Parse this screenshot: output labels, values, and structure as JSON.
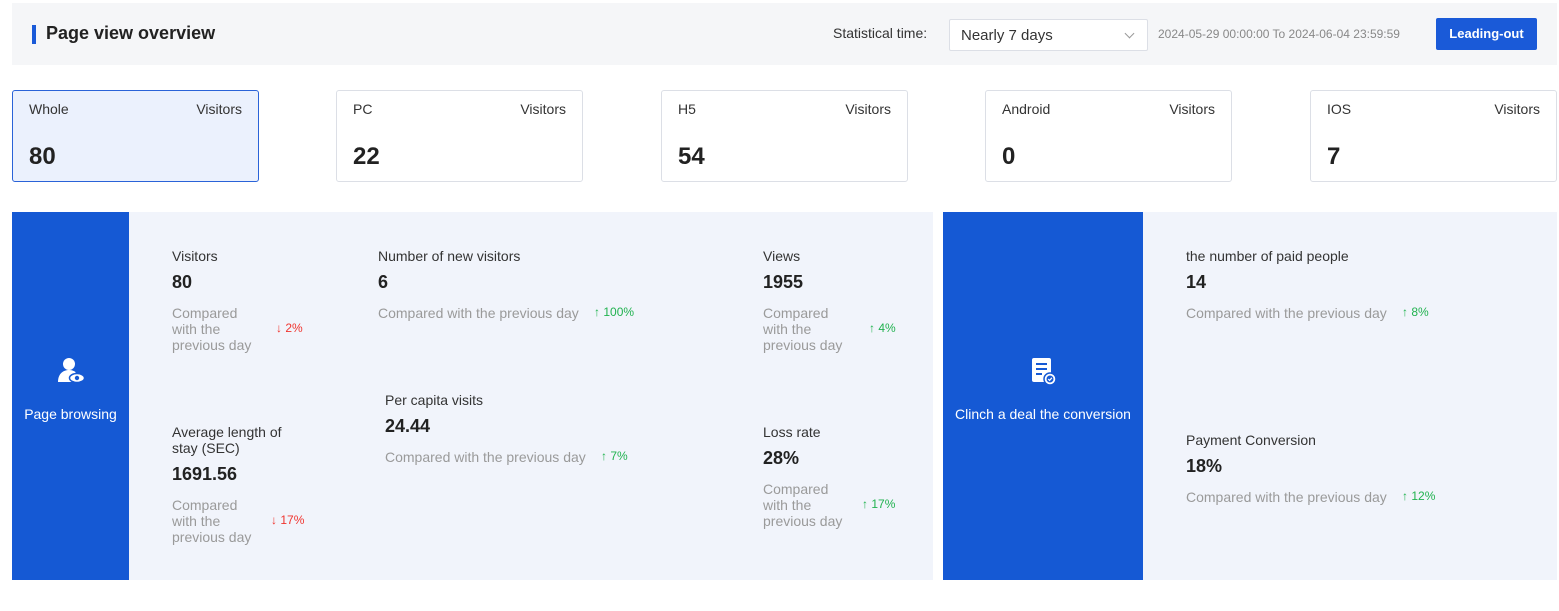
{
  "header": {
    "title": "Page view overview",
    "stat_label": "Statistical time:",
    "range_select": "Nearly 7 days",
    "range_text": "2024-05-29 00:00:00 To 2024-06-04 23:59:59",
    "export_label": "Leading-out"
  },
  "cards": [
    {
      "name": "Whole",
      "label": "Visitors",
      "value": "80"
    },
    {
      "name": "PC",
      "label": "Visitors",
      "value": "22"
    },
    {
      "name": "H5",
      "label": "Visitors",
      "value": "54"
    },
    {
      "name": "Android",
      "label": "Visitors",
      "value": "0"
    },
    {
      "name": "IOS",
      "label": "Visitors",
      "value": "7"
    }
  ],
  "browsing": {
    "title": "Page browsing",
    "icon": "user-eye-icon",
    "visitors": {
      "label": "Visitors",
      "value": "80",
      "compare": "Compared with the previous day",
      "delta": "2%",
      "dir": "down"
    },
    "new_visitors": {
      "label": "Number of new visitors",
      "value": "6",
      "compare": "Compared with the previous day",
      "delta": "100%",
      "dir": "up"
    },
    "views": {
      "label": "Views",
      "value": "1955",
      "compare": "Compared with the previous day",
      "delta": "4%",
      "dir": "up"
    },
    "avg_stay": {
      "label": "Average length of stay (SEC)",
      "value": "1691.56",
      "compare": "Compared with the previous day",
      "delta": "17%",
      "dir": "down"
    },
    "per_capita": {
      "label": "Per capita visits",
      "value": "24.44",
      "compare": "Compared with the previous day",
      "delta": "7%",
      "dir": "up"
    },
    "loss_rate": {
      "label": "Loss rate",
      "value": "28%",
      "compare": "Compared with the previous day",
      "delta": "17%",
      "dir": "up"
    }
  },
  "conversion": {
    "title": "Clinch a deal the conversion",
    "icon": "document-check-icon",
    "paid_people": {
      "label": "the number of paid people",
      "value": "14",
      "compare": "Compared with the previous day",
      "delta": "8%",
      "dir": "up"
    },
    "payment_conversion": {
      "label": "Payment Conversion",
      "value": "18%",
      "compare": "Compared with the previous day",
      "delta": "12%",
      "dir": "up"
    }
  },
  "colors": {
    "accent": "#1559d4",
    "up": "#21b24f",
    "down": "#f0342e"
  }
}
